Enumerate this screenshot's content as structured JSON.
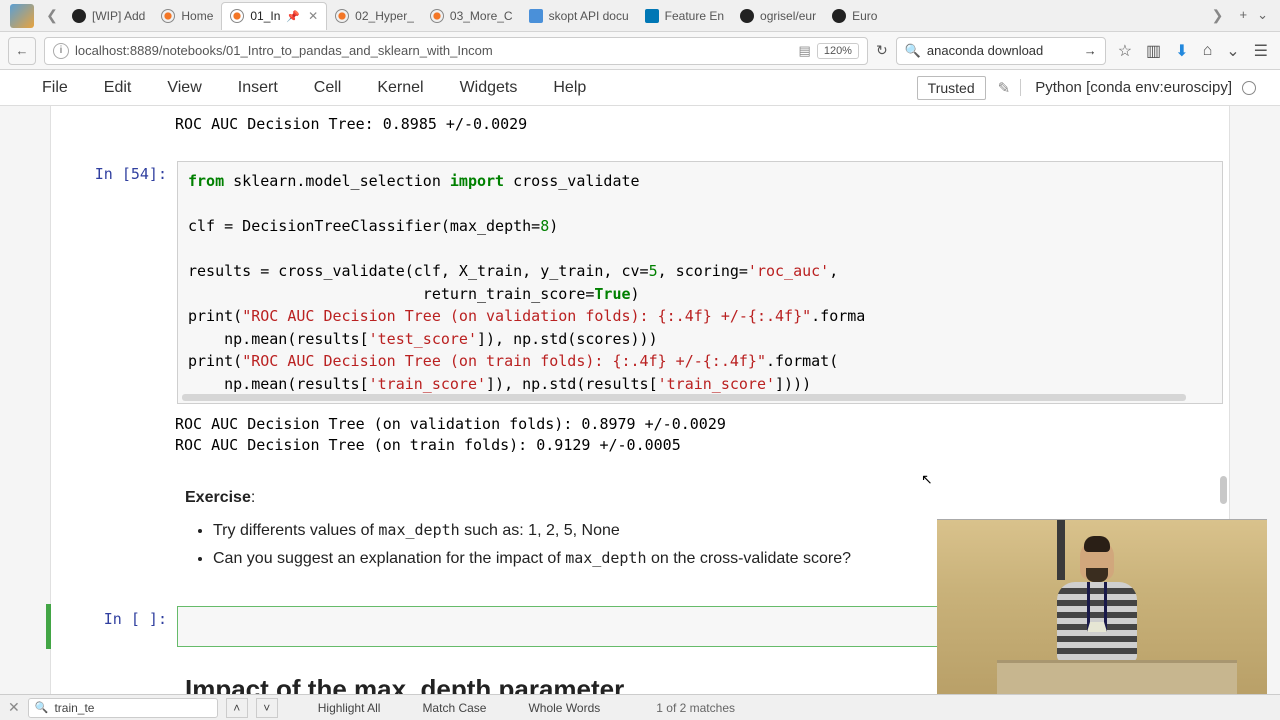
{
  "tabs": [
    {
      "icon": "github",
      "label": "[WIP] Add"
    },
    {
      "icon": "jupyter",
      "label": "Home"
    },
    {
      "icon": "jupyter",
      "label": "01_In",
      "active": true,
      "pinned": true
    },
    {
      "icon": "jupyter",
      "label": "02_Hyper_"
    },
    {
      "icon": "jupyter",
      "label": "03_More_C"
    },
    {
      "icon": "skopt",
      "label": "skopt API docu"
    },
    {
      "icon": "linkedin",
      "label": "Feature En"
    },
    {
      "icon": "github",
      "label": "ogrisel/eur"
    },
    {
      "icon": "github",
      "label": "Euro"
    }
  ],
  "url": "localhost:8889/notebooks/01_Intro_to_pandas_and_sklearn_with_Incom",
  "zoom": "120%",
  "search_value": "anaconda download",
  "menu": [
    "File",
    "Edit",
    "View",
    "Insert",
    "Cell",
    "Kernel",
    "Widgets",
    "Help"
  ],
  "trusted": "Trusted",
  "kernel": "Python [conda env:euroscipy]",
  "output_top": "ROC AUC Decision Tree: 0.8985 +/-0.0029",
  "cell54_prompt": "In [54]:",
  "cell54_output_l1": "ROC AUC Decision Tree (on validation folds): 0.8979 +/-0.0029",
  "cell54_output_l2": "ROC AUC Decision Tree (on train folds): 0.9129 +/-0.0005",
  "exercise_label": "Exercise",
  "exercise_b1_pre": "Try differents values of ",
  "exercise_b1_code": "max_depth",
  "exercise_b1_post": " such as: 1, 2, 5, None",
  "exercise_b2_pre": "Can you suggest an explanation for the impact of ",
  "exercise_b2_code": "max_depth",
  "exercise_b2_post": " on the cross-validate score?",
  "empty_prompt": "In [ ]:",
  "heading": "Impact of the max_depth parameter",
  "find_value": "train_te",
  "find_options": [
    "Highlight All",
    "Match Case",
    "Whole Words"
  ],
  "find_status": "1 of 2 matches"
}
